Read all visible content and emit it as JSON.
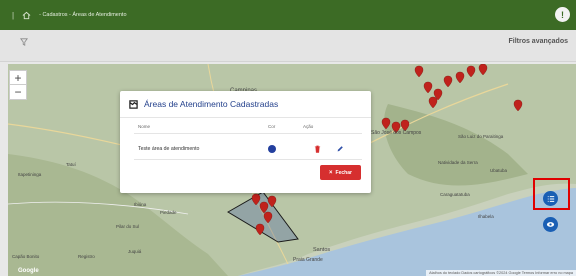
{
  "topbar": {
    "separator": "|",
    "title": "- Cadastros - Áreas de Atendimento",
    "info_label": "!"
  },
  "filterbar": {
    "advanced_label": "Filtros avançados"
  },
  "map": {
    "zoom_in": "+",
    "zoom_out": "−",
    "labels": [
      {
        "text": "Campinas",
        "id": "label-campinas"
      },
      {
        "text": "São José dos Campos",
        "id": "label-sjc"
      },
      {
        "text": "Santos",
        "id": "label-santos"
      },
      {
        "text": "Praia Grande",
        "id": "label-praia-grande"
      },
      {
        "text": "Natividade da Serra",
        "id": "label-natividade"
      },
      {
        "text": "Ubatuba",
        "id": "label-ubatuba"
      },
      {
        "text": "Caraguatatuba",
        "id": "label-caragua"
      },
      {
        "text": "Ilhabela",
        "id": "label-ilhabela"
      },
      {
        "text": "São Luiz do Paraitinga",
        "id": "label-saoluiz"
      },
      {
        "text": "Itapetininga",
        "id": "label-itapetininga"
      },
      {
        "text": "Piedade",
        "id": "label-piedade"
      },
      {
        "text": "Ibiúna",
        "id": "label-ibiuna"
      },
      {
        "text": "Tatuí",
        "id": "label-tatui"
      },
      {
        "text": "Pilar do Sul",
        "id": "label-pilar"
      },
      {
        "text": "Registro",
        "id": "label-registro"
      },
      {
        "text": "Capão Bonito",
        "id": "label-capao"
      },
      {
        "text": "Juquiá",
        "id": "label-juquia"
      }
    ],
    "attribution": "Atalhos do teclado  Dados cartográficos ©2024 Google  Termos  Informar erro no mapa",
    "google": "Google"
  },
  "modal": {
    "title": "Áreas de Atendimento Cadastradas",
    "columns": {
      "name": "Nome",
      "color": "Cor",
      "action": "Ação"
    },
    "rows": [
      {
        "name": "Teste área de atendimento",
        "color": "#233f9e"
      }
    ],
    "close_label": "Fechar",
    "close_icon": "×"
  },
  "colors": {
    "topbar": "#3c6b25",
    "modal_title": "#24418c",
    "close_button": "#d62f2f",
    "fab": "#1a5fb4",
    "highlight": "#e00000",
    "marker": "#c0221c"
  },
  "icons": [
    "home-icon",
    "funnel-icon",
    "info-icon",
    "map-marker-icon",
    "list-icon",
    "eye-icon",
    "trash-icon",
    "edit-icon",
    "close-icon",
    "modal-map-icon"
  ]
}
